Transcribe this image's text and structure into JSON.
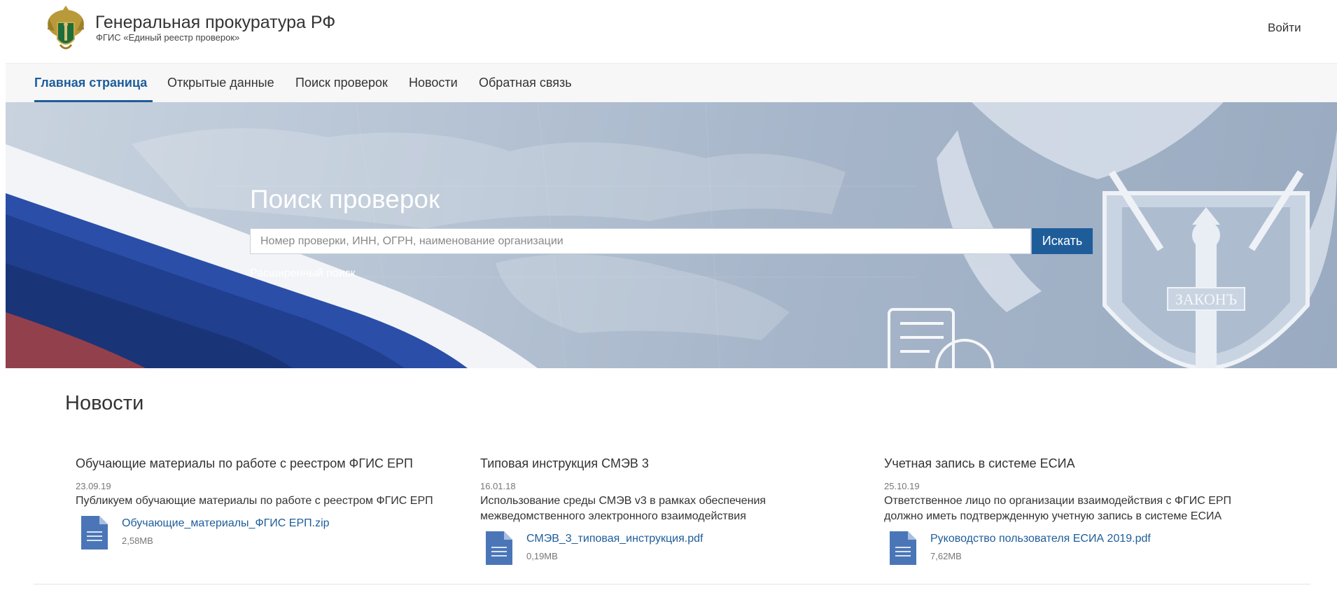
{
  "header": {
    "title": "Генеральная прокуратура РФ",
    "subtitle": "ФГИС «Единый реестр проверок»",
    "login_label": "Войти"
  },
  "nav": {
    "items": [
      {
        "label": "Главная страница",
        "active": true
      },
      {
        "label": "Открытые данные",
        "active": false
      },
      {
        "label": "Поиск проверок",
        "active": false
      },
      {
        "label": "Новости",
        "active": false
      },
      {
        "label": "Обратная связь",
        "active": false
      }
    ]
  },
  "hero": {
    "title": "Поиск проверок",
    "search_placeholder": "Номер проверки, ИНН, ОГРН, наименование организации",
    "search_value": "",
    "search_button": "Искать",
    "advanced_link": "Расширенный поиск",
    "emblem_text": "ЗАКОНЪ"
  },
  "news": {
    "title": "Новости",
    "items": [
      {
        "title": "Обучающие материалы по работе с реестром ФГИС ЕРП",
        "date": "23.09.19",
        "text": "Публикуем обучающие материалы по работе с реестром ФГИС ЕРП",
        "file_name": "Обучающие_материалы_ФГИС ЕРП.zip",
        "file_size": "2,58MB"
      },
      {
        "title": "Типовая инструкция СМЭВ 3",
        "date": "16.01.18",
        "text": "Использование среды СМЭВ v3 в рамках обеспечения межведомственного электронного взаимодействия",
        "file_name": "СМЭВ_3_типовая_инструкция.pdf",
        "file_size": "0,19MB"
      },
      {
        "title": "Учетная запись в системе ЕСИА",
        "date": "25.10.19",
        "text": "Ответственное лицо по организации взаимодействия с ФГИС ЕРП должно иметь подтвержденную учетную запись в системе ЕСИА",
        "file_name": "Руководство пользователя ЕСИА 2019.pdf",
        "file_size": "7,62MB"
      }
    ]
  },
  "colors": {
    "accent": "#1e5d9a",
    "file_icon": "#4a76b8"
  },
  "icons": {
    "logo": "prosecutor-emblem-icon",
    "file": "document-file-icon"
  }
}
